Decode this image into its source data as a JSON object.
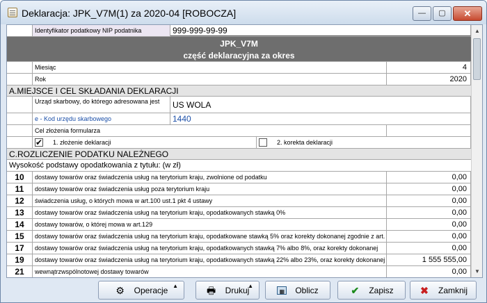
{
  "window": {
    "title": "Deklaracja: JPK_V7M(1) za 2020-04   [ROBOCZA]",
    "buttons": {
      "minimize": "—",
      "maximize": "▢",
      "close": "✕"
    }
  },
  "header": {
    "nip_label": "Identyfikator podatkowy NIP podatnika",
    "nip_value": "999-999-99-99",
    "form_title": "JPK_V7M",
    "form_subtitle": "część deklaracyjna za okres",
    "month_label": "Miesiąc",
    "month_value": "4",
    "year_label": "Rok",
    "year_value": "2020"
  },
  "section_a": {
    "title": "A.MIEJSCE I CEL SKŁADANIA DEKLARACJI",
    "office_label": "Urząd skarbowy, do którego adresowana jest",
    "office_value": "US WOLA",
    "code_label": "e - Kod urzędu skarbowego",
    "code_value": "1440",
    "purpose_label": "Cel złożenia formularza",
    "option1_label": "1. złożenie deklaracji",
    "option1_checked": true,
    "option2_label": "2. korekta deklaracji",
    "option2_checked": false
  },
  "section_c": {
    "title": "C.ROZLICZENIE PODATKU NALEŻNEGO",
    "subtitle": "Wysokość podstawy opodatkowania z tytułu: (w zł)",
    "rows": [
      {
        "num": "10",
        "label": "dostawy towarów oraz świadczenia usług na terytorium kraju, zwolnione od podatku",
        "value": "0,00"
      },
      {
        "num": "11",
        "label": "dostawy towarów oraz świadczenia usług poza terytorium kraju",
        "value": "0,00"
      },
      {
        "num": "12",
        "label": "świadczenia usług, o których mowa w art.100 ust.1 pkt 4 ustawy",
        "value": "0,00"
      },
      {
        "num": "13",
        "label": "dostawy towarów oraz świadczenia usług na terytorium kraju, opodatkowanych stawką 0%",
        "value": "0,00"
      },
      {
        "num": "14",
        "label": "dostawy towarów, o której mowa w art.129",
        "value": "0,00"
      },
      {
        "num": "15",
        "label": "dostawy towarów oraz świadczenia usług na terytorium kraju, opodatkowane stawką 5% oraz korekty dokonanej zgodnie z art.",
        "value": "0,00"
      },
      {
        "num": "17",
        "label": "dostawy towarów oraz świadczenia usług na terytorium kraju, opodatkowanych stawką 7% albo 8%, oraz korekty dokonanej",
        "value": "0,00"
      },
      {
        "num": "19",
        "label": "dostawy towarów oraz świadczenia usług na terytorium kraju, opodatkowanych stawką 22% albo 23%, oraz korekty dokonanej",
        "value": "1 555 555,00"
      },
      {
        "num": "21",
        "label": "wewnątrzwspólnotowej dostawy towarów",
        "value": "0,00"
      }
    ]
  },
  "toolbar": {
    "operations": "Operacje",
    "print": "Drukuj",
    "calculate": "Oblicz",
    "save": "Zapisz",
    "close": "Zamknij"
  }
}
